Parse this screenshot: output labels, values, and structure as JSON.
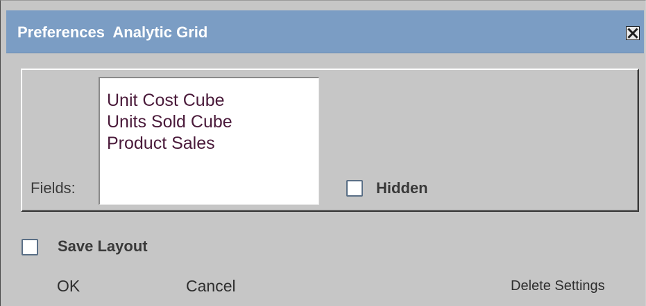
{
  "window": {
    "title": "Preferences  Analytic Grid",
    "close_icon": "close-icon"
  },
  "fields": {
    "label": "Fields:",
    "items": [
      "Unit Cost Cube",
      "Units Sold Cube",
      "Product Sales"
    ],
    "hidden_label": "Hidden",
    "hidden_checked": false
  },
  "options": {
    "save_layout_label": "Save Layout",
    "save_layout_checked": false
  },
  "actions": {
    "ok": "OK",
    "cancel": "Cancel",
    "delete_settings": "Delete Settings"
  },
  "colors": {
    "titlebar": "#7b9dc4",
    "dialog_bg": "#c6c6c6",
    "list_text": "#4a1a3a"
  }
}
